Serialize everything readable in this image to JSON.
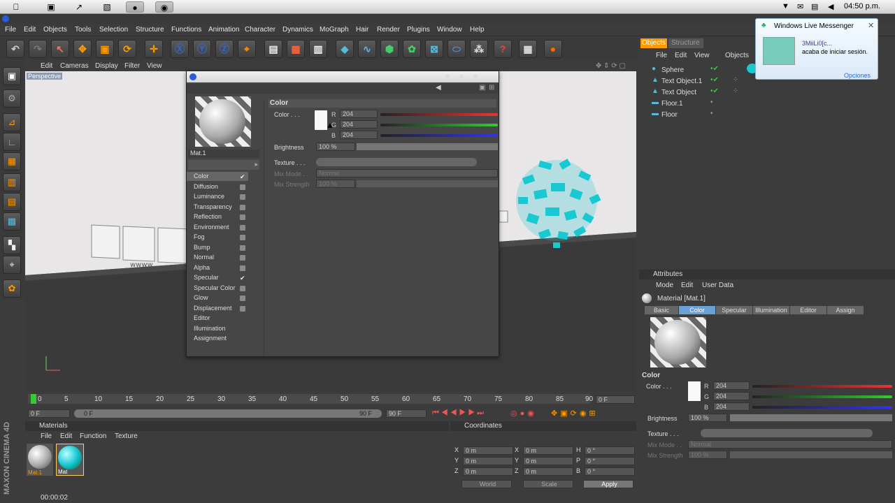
{
  "os": {
    "clock": "04:50 p.m."
  },
  "menu": [
    "File",
    "Edit",
    "Objects",
    "Tools",
    "Selection",
    "Structure",
    "Functions",
    "Animation",
    "Character",
    "Dynamics",
    "MoGraph",
    "Hair",
    "Render",
    "Plugins",
    "Window",
    "Help"
  ],
  "viewport": {
    "menu": [
      "Edit",
      "Cameras",
      "Display",
      "Filter",
      "View"
    ],
    "label": "Perspective"
  },
  "timeline": {
    "ticks": [
      "0",
      "5",
      "10",
      "15",
      "20",
      "25",
      "30",
      "35",
      "40",
      "45",
      "50",
      "55",
      "60",
      "65",
      "70",
      "75",
      "80",
      "85",
      "90"
    ],
    "frame_field": "0 F",
    "start": "0 F",
    "range_start": "0 F",
    "range_end": "90 F",
    "end": "90 F"
  },
  "materials": {
    "title": "Materials",
    "menu": [
      "File",
      "Edit",
      "Function",
      "Texture"
    ],
    "items": [
      "Mat.1",
      "Mat"
    ]
  },
  "coords": {
    "title": "Coordinates",
    "rows": [
      [
        "X",
        "0 m",
        "X",
        "0 m",
        "H",
        "0 °"
      ],
      [
        "Y",
        "0 m",
        "Y",
        "0 m",
        "P",
        "0 °"
      ],
      [
        "Z",
        "0 m",
        "Z",
        "0 m",
        "B",
        "0 °"
      ]
    ],
    "world": "World",
    "scale": "Scale",
    "apply": "Apply"
  },
  "status": {
    "time": "00:00:02"
  },
  "objects": {
    "tabs": [
      "Objects",
      "Structure"
    ],
    "menu": [
      "File",
      "Edit",
      "View",
      "Objects"
    ],
    "items": [
      "Sphere",
      "Text Object.1",
      "Text Object",
      "Floor.1",
      "Floor"
    ]
  },
  "attributes": {
    "title": "Attributes",
    "menu": [
      "Mode",
      "Edit",
      "User Data"
    ],
    "material": "Material [Mat.1]",
    "tabs": [
      "Basic",
      "Color",
      "Specular",
      "Illumination",
      "Editor",
      "Assign"
    ],
    "section": "Color",
    "color_label": "Color . . .",
    "r": "204",
    "g": "204",
    "b": "204",
    "brightness_label": "Brightness",
    "brightness": "100 %",
    "texture_label": "Texture . . .",
    "mixmode_label": "Mix Mode . .",
    "mixmode": "Normal",
    "mixstrength_label": "Mix Strength",
    "mixstrength": "100 %"
  },
  "dialog": {
    "mat_name": "Mat.1",
    "section": "Color",
    "channels": [
      "Color",
      "Diffusion",
      "Luminance",
      "Transparency",
      "Reflection",
      "Environment",
      "Fog",
      "Bump",
      "Normal",
      "Alpha",
      "Specular",
      "Specular Color",
      "Glow",
      "Displacement",
      "Editor",
      "Illumination",
      "Assignment"
    ],
    "checked": [
      true,
      false,
      false,
      false,
      false,
      false,
      false,
      false,
      false,
      false,
      true,
      false,
      false,
      false
    ],
    "color_label": "Color . . .",
    "r": "204",
    "g": "204",
    "b": "204",
    "brightness_label": "Brightness",
    "brightness": "100 %",
    "texture_label": "Texture . . .",
    "mixmode_label": "Mix Mode . .",
    "mixmode": "Normal",
    "mixstrength_label": "Mix Strength",
    "mixstrength": "100 %"
  },
  "messenger": {
    "title": "Windows Live Messenger",
    "user": "3MiiLi0[c...",
    "text": "acaba de iniciar sesión.",
    "options": "Opciones"
  },
  "brand": "MAXON CINEMA 4D",
  "colors": {
    "accent_cyan": "#19c9d2",
    "tab_active": "#6aa0d8",
    "red": "#e33",
    "green": "#3c3",
    "blue": "#33e"
  }
}
